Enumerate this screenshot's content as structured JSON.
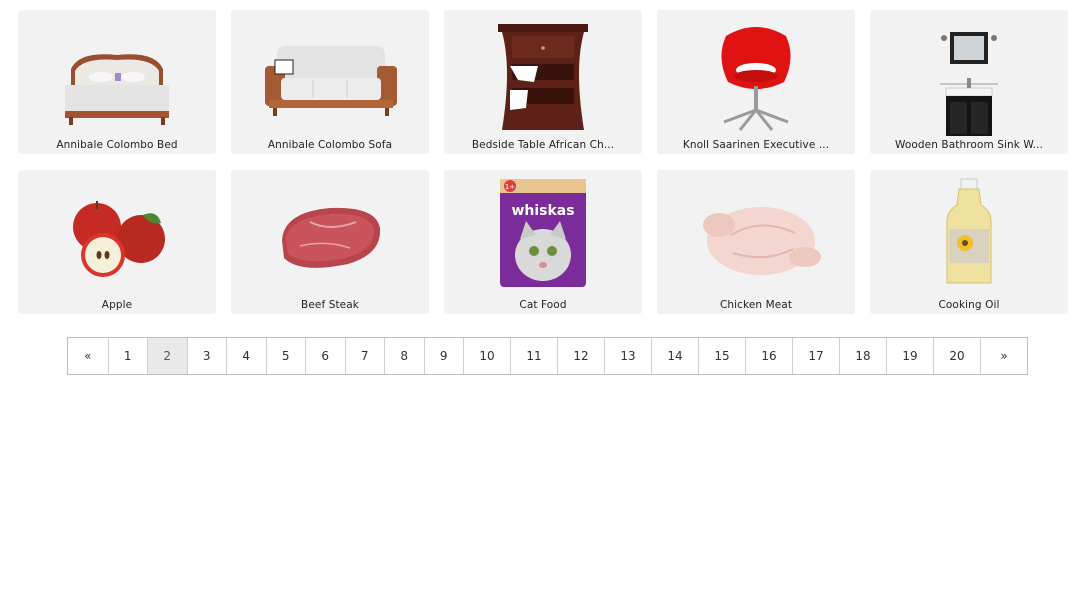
{
  "products": [
    {
      "name": "Annibale Colombo Bed",
      "icon": "bed-icon"
    },
    {
      "name": "Annibale Colombo Sofa",
      "icon": "sofa-icon"
    },
    {
      "name": "Bedside Table African Ch...",
      "icon": "bedside-table-icon"
    },
    {
      "name": "Knoll Saarinen Executive ...",
      "icon": "office-chair-icon"
    },
    {
      "name": "Wooden Bathroom Sink W...",
      "icon": "bathroom-sink-icon"
    },
    {
      "name": "Apple",
      "icon": "apple-icon"
    },
    {
      "name": "Beef Steak",
      "icon": "steak-icon"
    },
    {
      "name": "Cat Food",
      "icon": "cat-food-pouch-icon",
      "brand_text": "whiskas",
      "badge_text": "1+"
    },
    {
      "name": "Chicken Meat",
      "icon": "raw-chicken-icon"
    },
    {
      "name": "Cooking Oil",
      "icon": "oil-bottle-icon"
    }
  ],
  "pagination": {
    "prev": "«",
    "pages": [
      "1",
      "2",
      "3",
      "4",
      "5",
      "6",
      "7",
      "8",
      "9",
      "10",
      "11",
      "12",
      "13",
      "14",
      "15",
      "16",
      "17",
      "18",
      "19",
      "20"
    ],
    "next": "»",
    "current": "2"
  }
}
